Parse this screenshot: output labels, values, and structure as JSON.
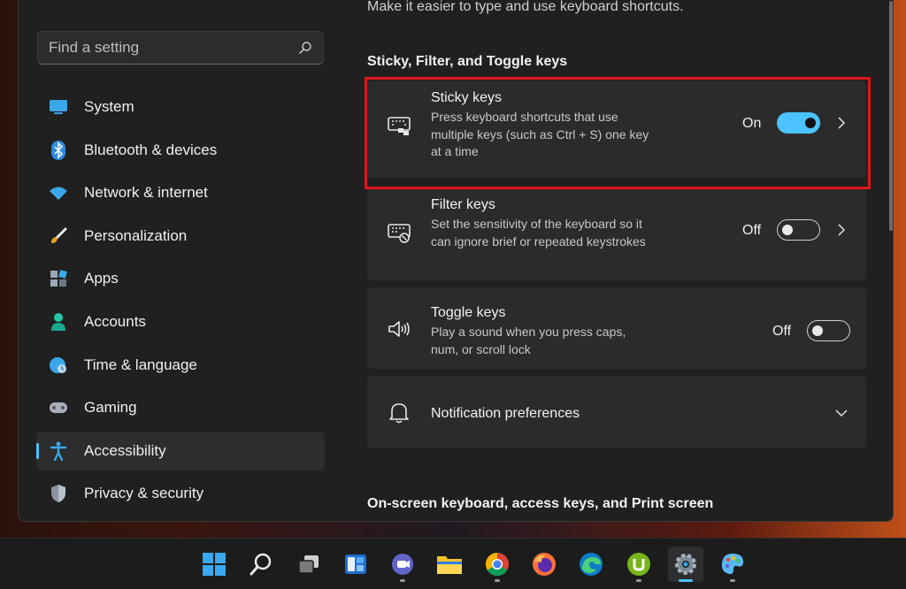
{
  "search": {
    "placeholder": "Find a setting"
  },
  "sidebar": {
    "items": [
      {
        "label": "System",
        "icon": "monitor-icon"
      },
      {
        "label": "Bluetooth & devices",
        "icon": "bluetooth-icon"
      },
      {
        "label": "Network & internet",
        "icon": "wifi-icon"
      },
      {
        "label": "Personalization",
        "icon": "brush-icon"
      },
      {
        "label": "Apps",
        "icon": "apps-icon"
      },
      {
        "label": "Accounts",
        "icon": "person-icon"
      },
      {
        "label": "Time & language",
        "icon": "globe-clock-icon"
      },
      {
        "label": "Gaming",
        "icon": "gamepad-icon"
      },
      {
        "label": "Accessibility",
        "icon": "accessibility-icon",
        "active": true
      },
      {
        "label": "Privacy & security",
        "icon": "shield-icon"
      }
    ]
  },
  "content": {
    "subtitle": "Make it easier to type and use keyboard shortcuts.",
    "section1_title": "Sticky, Filter, and Toggle keys",
    "section2_title": "On-screen keyboard, access keys, and Print screen",
    "cards": [
      {
        "title": "Sticky keys",
        "desc": "Press keyboard shortcuts that use multiple keys (such as Ctrl + S) one key at a time",
        "state": "On",
        "toggle_on": true,
        "icon": "sticky-keyboard-icon"
      },
      {
        "title": "Filter keys",
        "desc": "Set the sensitivity of the keyboard so it can ignore brief or repeated keystrokes",
        "state": "Off",
        "toggle_on": false,
        "icon": "filter-keyboard-icon"
      },
      {
        "title": "Toggle keys",
        "desc": "Play a sound when you press caps, num, or scroll lock",
        "state": "Off",
        "toggle_on": false,
        "icon": "speaker-icon"
      },
      {
        "title": "Notification preferences",
        "icon": "bell-icon"
      }
    ]
  },
  "colors": {
    "accent": "#4cc2ff",
    "highlight": "#e0151c",
    "card": "#2b2b2b",
    "window": "#202020"
  },
  "taskbar": {
    "icons": [
      "windows-start-icon",
      "search-icon",
      "task-view-icon",
      "widgets-icon",
      "teams-chat-icon",
      "file-explorer-icon",
      "chrome-icon",
      "firefox-icon",
      "edge-icon",
      "utorrent-icon",
      "settings-icon",
      "paint-icon"
    ]
  }
}
